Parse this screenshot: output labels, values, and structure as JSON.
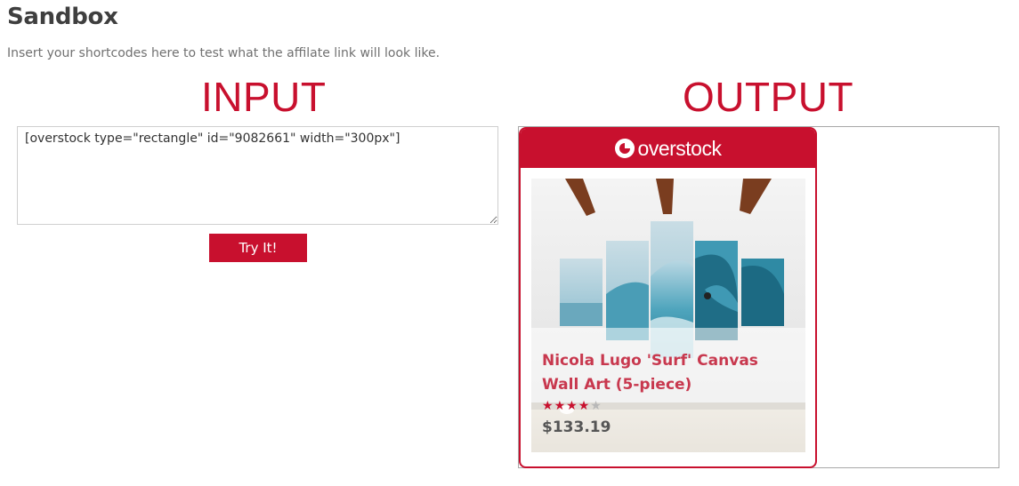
{
  "page": {
    "title": "Sandbox",
    "subtitle": "Insert your shortcodes here to test what the affilate link will look like."
  },
  "input": {
    "heading": "INPUT",
    "shortcode_value": "[overstock type=\"rectangle\" id=\"9082661\" width=\"300px\"]",
    "button_label": "Try It!"
  },
  "output": {
    "heading": "OUTPUT",
    "widget": {
      "brand_logo_text": "overstock",
      "brand_icon": "overstock-logo-icon",
      "product_name": "Nicola Lugo 'Surf' Canvas Wall Art (5-piece)",
      "rating": {
        "stars_filled": 4,
        "stars_total": 5
      },
      "price": "$133.19"
    }
  },
  "colors": {
    "accent": "#c8102e",
    "text_muted": "#707070",
    "title": "#3f3f3f"
  }
}
